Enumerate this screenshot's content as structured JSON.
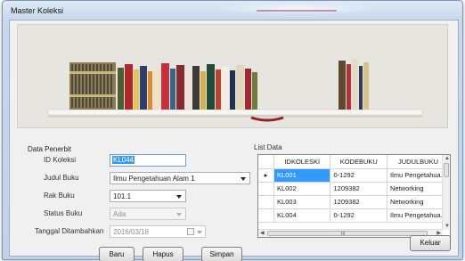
{
  "window": {
    "title": "Master Koleksi"
  },
  "form": {
    "group_label": "Data Penerbit",
    "fields": {
      "id_koleksi": {
        "label": "ID Koleksi",
        "value": "KL044"
      },
      "judul_buku": {
        "label": "Judul Buku",
        "value": "Ilmu Pengetahuan Alam 1"
      },
      "rak_buku": {
        "label": "Rak Buku",
        "value": "101.1"
      },
      "status_buku": {
        "label": "Status Buku",
        "value": "Ada"
      },
      "tanggal": {
        "label": "Tanggal Ditambahkan",
        "value": "2016/03/18"
      }
    },
    "buttons": {
      "baru": "Baru",
      "hapus": "Hapus",
      "simpan": "Simpan"
    }
  },
  "list": {
    "label": "List Data",
    "columns": [
      "IDKOLESKI",
      "KODEBUKU",
      "JUDULBUKU"
    ],
    "rows": [
      {
        "id": "KL001",
        "kode": "0-1292",
        "judul": "Ilmu Pengetahua..."
      },
      {
        "id": "KL002",
        "kode": "1209382",
        "judul": "Networking"
      },
      {
        "id": "KL003",
        "kode": "1209382",
        "judul": "Networking"
      },
      {
        "id": "KL004",
        "kode": "0-1292",
        "judul": "Ilmu Pengetahua..."
      }
    ],
    "row_marker": "▸",
    "scroll_mark": "III"
  },
  "footer": {
    "keluar": "Keluar"
  },
  "colors": {
    "accent_selection": "#3399ff",
    "window_frame": "#bfd2e8"
  },
  "banner_image": {
    "icon": "bookshelf-banner"
  }
}
